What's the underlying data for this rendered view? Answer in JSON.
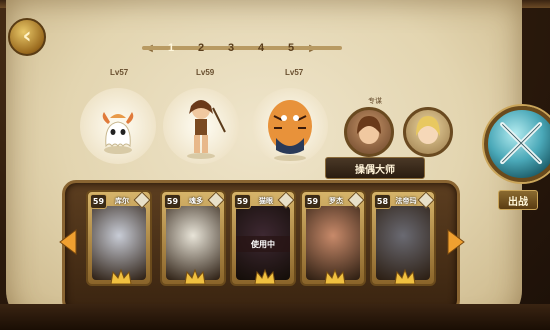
{
  "pagination": {
    "pages": [
      "1",
      "2",
      "3",
      "4",
      "5"
    ],
    "active_index": 0
  },
  "levels": [
    "Lv57",
    "Lv59",
    "Lv57"
  ],
  "support": {
    "label": "专谋",
    "skill_name": "操偶大师"
  },
  "battle": {
    "label": "出战"
  },
  "cards": [
    {
      "level": "59",
      "name": "库尔",
      "accent": "#c8ccd6",
      "in_use": false
    },
    {
      "level": "59",
      "name": "魂多",
      "accent": "#e8e4d8",
      "in_use": false
    },
    {
      "level": "59",
      "name": "猫眼",
      "accent": "#8a5a70",
      "in_use": true,
      "in_use_label": "使用中"
    },
    {
      "level": "59",
      "name": "罗杰",
      "accent": "#c88a6a",
      "in_use": false
    },
    {
      "level": "58",
      "name": "法帝玛",
      "accent": "#6a6a72",
      "in_use": false
    }
  ],
  "colors": {
    "parchment": "#e9dcbc",
    "wood": "#5c3e20",
    "gold": "#caa55a",
    "battle_teal": "#4aa8b8"
  }
}
